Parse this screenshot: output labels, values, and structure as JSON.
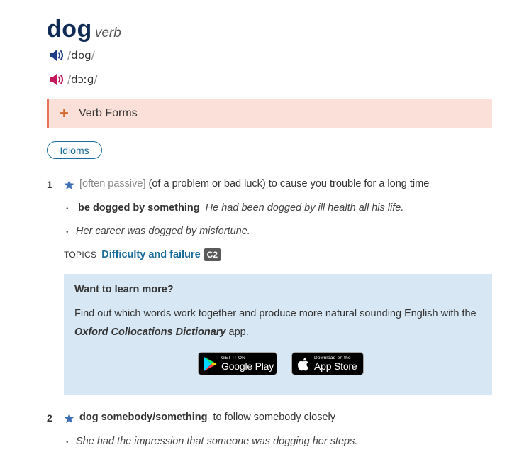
{
  "entry": {
    "headword": "dog",
    "pos": "verb",
    "pron_br": "dɒɡ",
    "pron_am": "dɔːɡ",
    "pron_br_color": "#1f3c88",
    "pron_am_color": "#c2185b"
  },
  "verb_forms": {
    "plus": "+",
    "label": "Verb Forms"
  },
  "idioms_button": "Idioms",
  "senses": [
    {
      "num": "1",
      "grammar": "[often passive]",
      "definition": "(of a problem or bad luck) to cause you trouble for a long time",
      "examples": [
        {
          "collocation": "be dogged by something",
          "text": "He had been dogged by ill health all his life."
        },
        {
          "collocation": "",
          "text": "Her career was dogged by misfortune."
        }
      ],
      "topics_label": "TOPICS",
      "topic": "Difficulty and failure",
      "level": "C2"
    },
    {
      "num": "2",
      "collocation": "dog somebody/something",
      "definition": "to follow somebody closely",
      "examples": [
        {
          "text": "She had the impression that someone was dogging her steps."
        }
      ]
    }
  ],
  "promo": {
    "title": "Want to learn more?",
    "body_before": "Find out which words work together and produce more natural sounding English with the ",
    "body_bold": "Oxford Collocations Dictionary",
    "body_after": " app.",
    "google_small": "GET IT ON",
    "google_big": "Google Play",
    "apple_small": "Download on the",
    "apple_big": "App Store"
  },
  "colors": {
    "headword": "#0f2b56",
    "link": "#1a6c9b",
    "star": "#3f6fb5",
    "verb_forms_bg": "#fbe0d9",
    "promo_bg": "#d7e7f3"
  },
  "icons": [
    "speaker-br-icon",
    "speaker-am-icon",
    "plus-icon",
    "star-icon",
    "google-play-icon",
    "apple-icon"
  ]
}
